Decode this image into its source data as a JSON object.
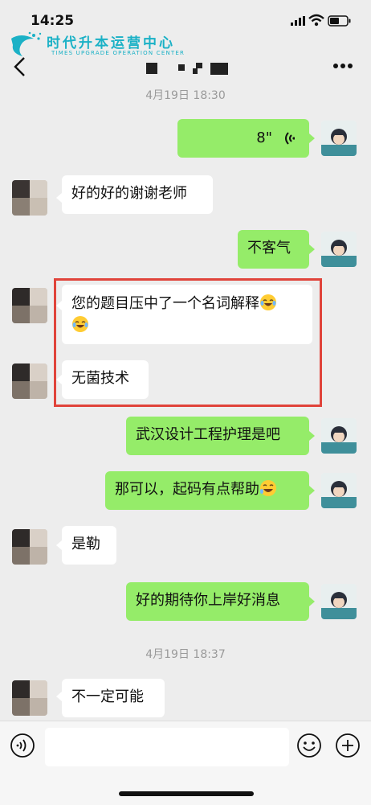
{
  "status": {
    "time": "14:25"
  },
  "logo": {
    "cn": "时代升本运营中心",
    "en": "TIMES UPGRADE OPERATION CENTER"
  },
  "nav": {
    "title_redacted": true
  },
  "timestamps": [
    "4月19日 18:30",
    "4月19日 18:37"
  ],
  "messages": [
    {
      "side": "right",
      "type": "voice",
      "text": "8\""
    },
    {
      "side": "left",
      "text": "好的好的谢谢老师"
    },
    {
      "side": "right",
      "text": "不客气"
    },
    {
      "side": "left",
      "text": "您的题目压中了一个名词解释",
      "emoji": "laugh-tears"
    },
    {
      "side": "left",
      "text": "无菌技术"
    },
    {
      "side": "right",
      "text": "武汉设计工程护理是吧"
    },
    {
      "side": "right",
      "text": "那可以，起码有点帮助",
      "emoji": "rolling-laugh"
    },
    {
      "side": "left",
      "text": "是勒"
    },
    {
      "side": "right",
      "text": "好的期待你上岸好消息"
    },
    {
      "side": "left",
      "text": "不一定可能"
    }
  ],
  "colors": {
    "bg": "#ededed",
    "bubble_mine": "#95ec69",
    "bubble_other": "#ffffff",
    "highlight": "#e0433a"
  }
}
